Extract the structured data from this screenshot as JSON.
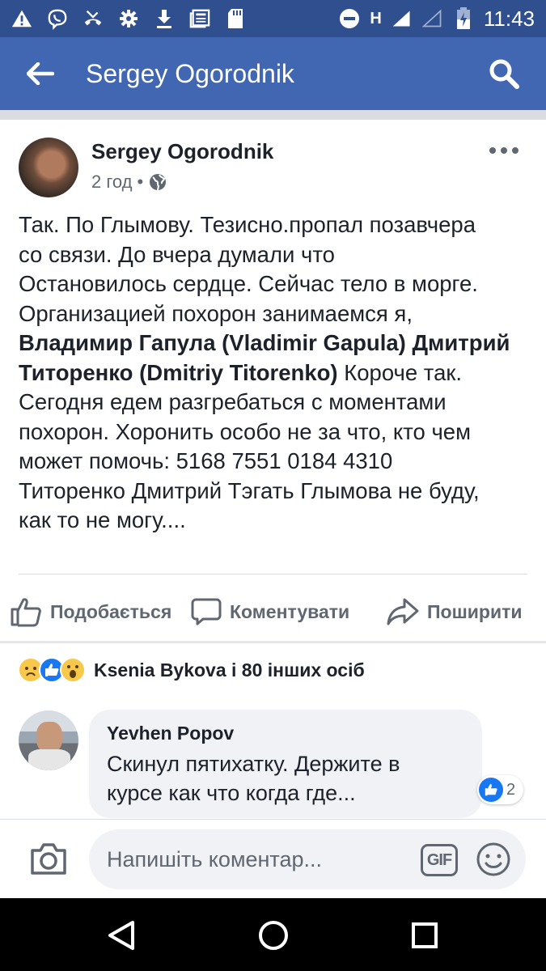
{
  "status_bar": {
    "time": "11:43",
    "network": "H",
    "icons": [
      "warning-icon",
      "viber-icon",
      "missed-call-icon",
      "settings-icon",
      "download-icon",
      "news-icon",
      "sd-card-icon",
      "do-not-disturb-icon",
      "signal-icon",
      "battery-icon"
    ]
  },
  "app_bar": {
    "title": "Sergey Ogorodnik",
    "back_icon": "arrow-left-icon",
    "search_icon": "search-icon",
    "background": "#4267b2"
  },
  "post": {
    "author": "Sergey Ogorodnik",
    "time": "2 год",
    "separator": "•",
    "privacy_icon": "globe-icon",
    "body": {
      "line1": "Так. По Глымову. Тезисно.пропал позавчера",
      "line2": "со связи. До вчера думали что",
      "line3": "Остановилось сердце. Сейчас тело в морге.",
      "line4": "Организацией похорон занимаемся я,",
      "tag1": "Владимир Гапула (Vladimir Gapula)",
      "tag2": "Дмитрий Титоренко (Dmitriy Titorenko)",
      "after_tags": " Короче так.",
      "line6": "Сегодня едем разгребаться с моментами",
      "line7": "похорон. Хоронить особо не за что, кто чем",
      "line8": "может помочь: 5168 7551 0184 4310",
      "line9": "Титоренко Дмитрий Тэгать Глымова не буду,",
      "line10": "как то не могу...."
    },
    "actions": {
      "like": "Подобається",
      "comment": "Коментувати",
      "share": "Поширити"
    },
    "reactions": {
      "types": [
        "sad",
        "like",
        "wow"
      ],
      "summary": "Ksenia Bykova і 80 інших осіб"
    }
  },
  "comment": {
    "author": "Yevhen Popov",
    "line1": "Скинул пятихатку. Держите в",
    "line2": "курсе как что когда где...",
    "like_count": "2"
  },
  "composer": {
    "placeholder": "Напишіть коментар...",
    "gif_label": "GIF"
  },
  "nav_bar": {
    "buttons": [
      "back",
      "home",
      "recent-apps"
    ]
  }
}
